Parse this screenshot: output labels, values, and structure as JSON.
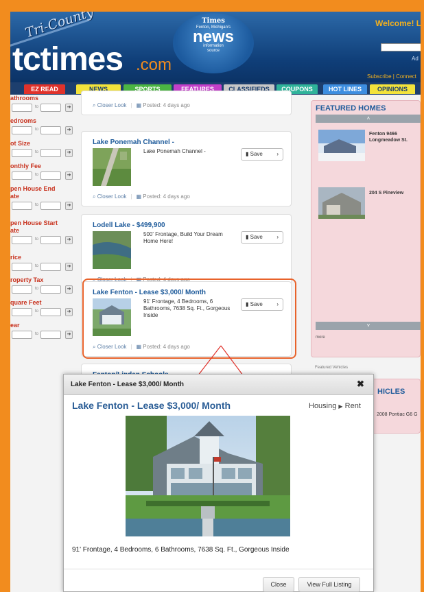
{
  "header": {
    "tricounty": "Tri-County",
    "logo_main": "tctimes",
    "logo_com": ".com",
    "badge_line1": "Times",
    "badge_line2": "Fenton, Michigan's",
    "badge_line3": "news",
    "badge_line4": "information",
    "badge_line5": "source",
    "welcome": "Welcome! Lo",
    "ad_text": "Ad",
    "subscribe": "Subscribe | Connect"
  },
  "nav": {
    "tabs": [
      {
        "label": "EZ READ",
        "color": "#e0322b",
        "text": "#ffffff"
      },
      {
        "label": "NEWS",
        "color": "#f3e33b",
        "text": "#1d3f6e"
      },
      {
        "label": "SPORTS",
        "color": "#4bb543",
        "text": "#ffffff"
      },
      {
        "label": "FEATURES",
        "color": "#c33fc9",
        "text": "#ffffff"
      },
      {
        "label": "CLASSIFIEDS",
        "color": "#c7c7c7",
        "text": "#1d3f6e"
      },
      {
        "label": "COUPONS",
        "color": "#2fb39a",
        "text": "#ffffff"
      },
      {
        "label": "HOT LINES",
        "color": "#3d8ee0",
        "text": "#ffffff"
      },
      {
        "label": "OPINIONS",
        "color": "#f3e33b",
        "text": "#1d3f6e"
      }
    ]
  },
  "filters": {
    "items": [
      "athrooms",
      "edrooms",
      "ot Size",
      "onthly Fee",
      "pen House End\nate",
      "pen House Start\nate",
      "rice",
      "roperty Tax",
      "quare Feet",
      "ear"
    ],
    "to_label": "to",
    "go_label": "➔"
  },
  "listings": {
    "closer_look": "Closer Look",
    "posted": "Posted: 4 days ago",
    "save": "Save",
    "cards": [
      {
        "title": "Lake Ponemah Channel -",
        "desc": "Lake Ponemah Channel -"
      },
      {
        "title": "Lodell Lake - $499,900",
        "desc": "500' Frontage, Build Your Dream Home Here!"
      },
      {
        "title": "Lake Fenton - Lease $3,000/ Month",
        "desc": "91' Frontage, 4 Bedrooms, 6 Bathrooms, 7638 Sq. Ft., Gorgeous Inside"
      },
      {
        "title": "Fenton/Linden Schools",
        "desc": ""
      }
    ]
  },
  "featured": {
    "title": "FEATURED HOMES",
    "items": [
      {
        "label": "Fenton 9466\nLongmeadow St."
      },
      {
        "label": "204 S Pineview"
      }
    ],
    "footer": "more",
    "vehicles_tab": "Featured Vehicles",
    "vehicles_title": "HICLES",
    "vehicle_item": "2008 Pontiac G6 G"
  },
  "modal": {
    "header_title": "Lake Fenton - Lease $3,000/ Month",
    "close_glyph": "✖",
    "title": "Lake Fenton - Lease $3,000/ Month",
    "category": "Housing",
    "subcategory": "Rent",
    "description": "91' Frontage, 4 Bedrooms, 6 Bathrooms, 7638 Sq. Ft., Gorgeous Inside",
    "close_button": "Close",
    "view_button": "View Full Listing"
  },
  "colors": {
    "frame": "#f28c1e",
    "header_blue": "#0f3e78",
    "highlight": "#e8622a",
    "link_blue": "#2a5d96"
  }
}
